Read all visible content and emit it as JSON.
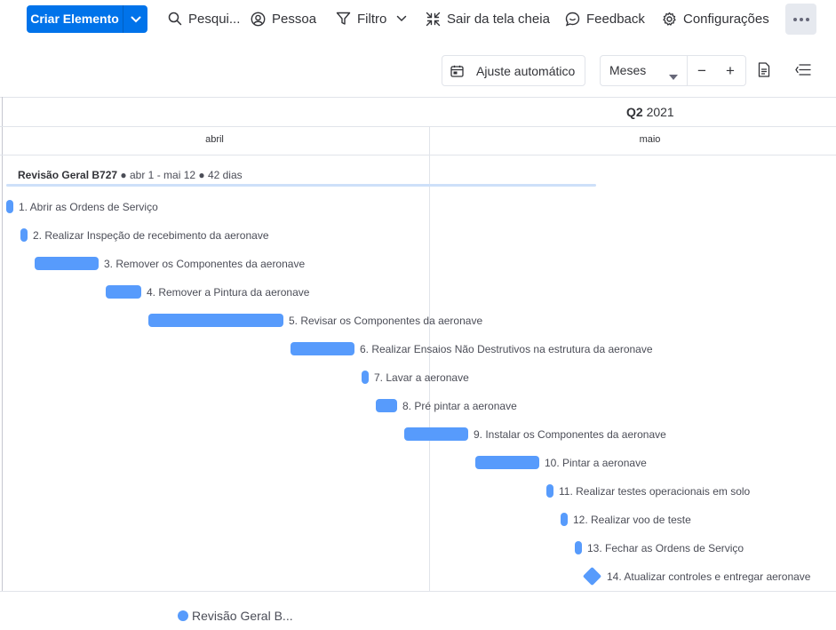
{
  "toolbar": {
    "create_label": "Criar Elemento",
    "search_label": "Pesqui...",
    "person_label": "Pessoa",
    "filter_label": "Filtro",
    "exit_fullscreen_label": "Sair da tela cheia",
    "feedback_label": "Feedback",
    "settings_label": "Configurações"
  },
  "controls": {
    "autofit_label": "Ajuste automático",
    "period_value": "Meses",
    "zoom_out": "−",
    "zoom_in": "+"
  },
  "timeline": {
    "quarter": "Q2",
    "year": "2021",
    "months": [
      "abril",
      "maio"
    ]
  },
  "group": {
    "name": "Revisão Geral B727",
    "range": "● abr 1 - mai 12 ● 42 dias"
  },
  "tasks": [
    "1. Abrir as Ordens de Serviço",
    "2. Realizar Inspeção de recebimento da aeronave",
    "3. Remover os Componentes da aeronave",
    "4. Remover a Pintura da aeronave",
    "5. Revisar os Componentes da aeronave",
    "6. Realizar Ensaios Não Destrutivos na estrutura da aeronave",
    "7. Lavar a aeronave",
    "8. Pré pintar a aeronave",
    "9. Instalar os Componentes da aeronave",
    "10. Pintar a aeronave",
    "11. Realizar testes operacionais em solo",
    "12. Realizar voo de teste",
    "13. Fechar as Ordens de Serviço",
    "14. Atualizar controles e entregar aeronave"
  ],
  "legend": {
    "label": "Revisão Geral B..."
  },
  "colors": {
    "accent": "#0073ea",
    "bar": "#579bfc",
    "group_line": "#cde0f9"
  }
}
